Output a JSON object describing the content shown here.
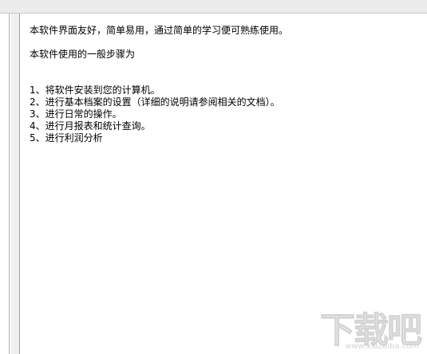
{
  "content": {
    "intro": "本软件界面友好，简单易用，通过简单的学习便可熟练使用。",
    "steps_heading": "本软件使用的一般步骤为",
    "steps": [
      "1、将软件安装到您的计算机。",
      "2、进行基本档案的设置（详细的说明请参阅相关的文档）。",
      "3、进行日常的操作。",
      "4、进行月报表和统计查询。",
      "5、进行利润分析"
    ]
  },
  "watermark": {
    "logo_text": "下载吧",
    "site": "www.xiazaiba.com"
  }
}
